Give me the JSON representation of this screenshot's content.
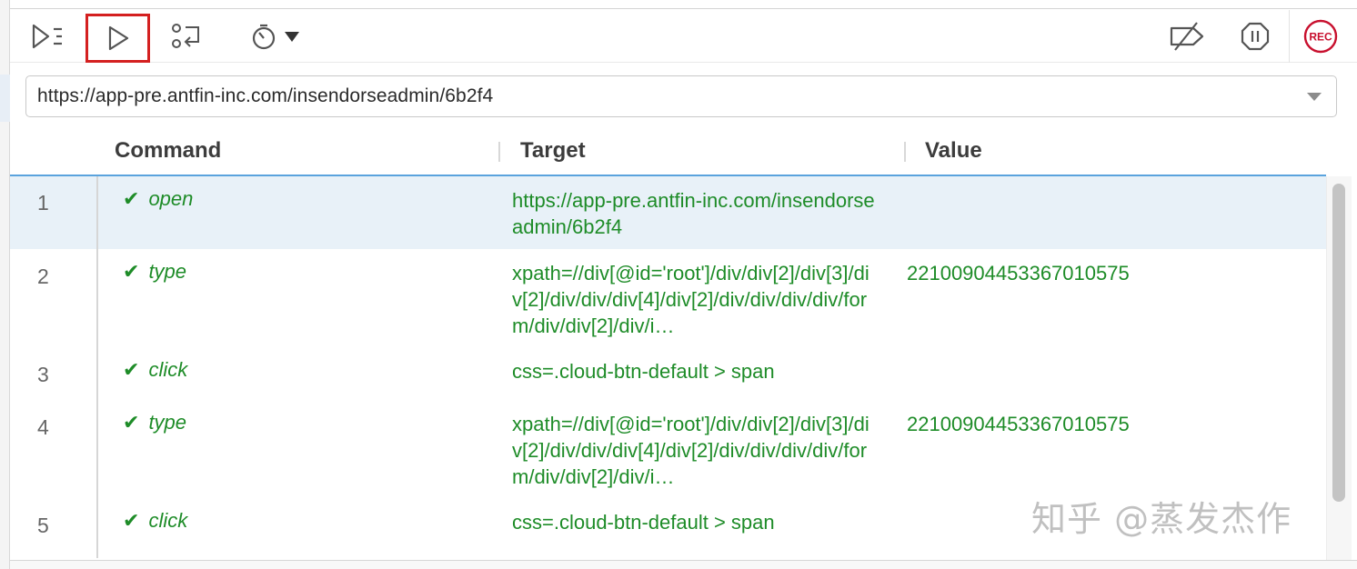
{
  "toolbar": {
    "run_all_icon": "run-all-icon",
    "run_current_icon": "play-icon",
    "step_icon": "step-over-icon",
    "speed_icon": "stopwatch-icon",
    "disable_breakpoints_icon": "breakpoint-disabled-icon",
    "pause_icon": "pause-icon",
    "record_label": "REC",
    "active_button_outline": "#d42020",
    "record_color": "#c8102e"
  },
  "url": {
    "value": "https://app-pre.antfin-inc.com/insendorseadmin/6b2f4"
  },
  "table": {
    "headers": {
      "command": "Command",
      "target": "Target",
      "value": "Value"
    },
    "rows": [
      {
        "num": "1",
        "status": "✔",
        "command": "open",
        "target": "https://app-pre.antfin-inc.com/insendorseadmin/6b2f4",
        "value": ""
      },
      {
        "num": "2",
        "status": "✔",
        "command": "type",
        "target": "xpath=//div[@id='root']/div/div[2]/div[3]/div[2]/div/div/div[4]/div[2]/div/div/div/div/form/div/div[2]/div/i…",
        "value": "2210090445336701057​5"
      },
      {
        "num": "3",
        "status": "✔",
        "command": "click",
        "target": "css=.cloud-btn-default > span",
        "value": ""
      },
      {
        "num": "4",
        "status": "✔",
        "command": "type",
        "target": "xpath=//div[@id='root']/div/div[2]/div[3]/div[2]/div/div/div[4]/div[2]/div/div/div/div/form/div/div[2]/div/i…",
        "value": "2210090445336701057​5"
      },
      {
        "num": "5",
        "status": "✔",
        "command": "click",
        "target": "css=.cloud-btn-default > span",
        "value": ""
      }
    ],
    "success_color": "#1e8c28",
    "selected_row_color": "#e8f1f8"
  },
  "watermark": "知乎 @蒸发杰作"
}
